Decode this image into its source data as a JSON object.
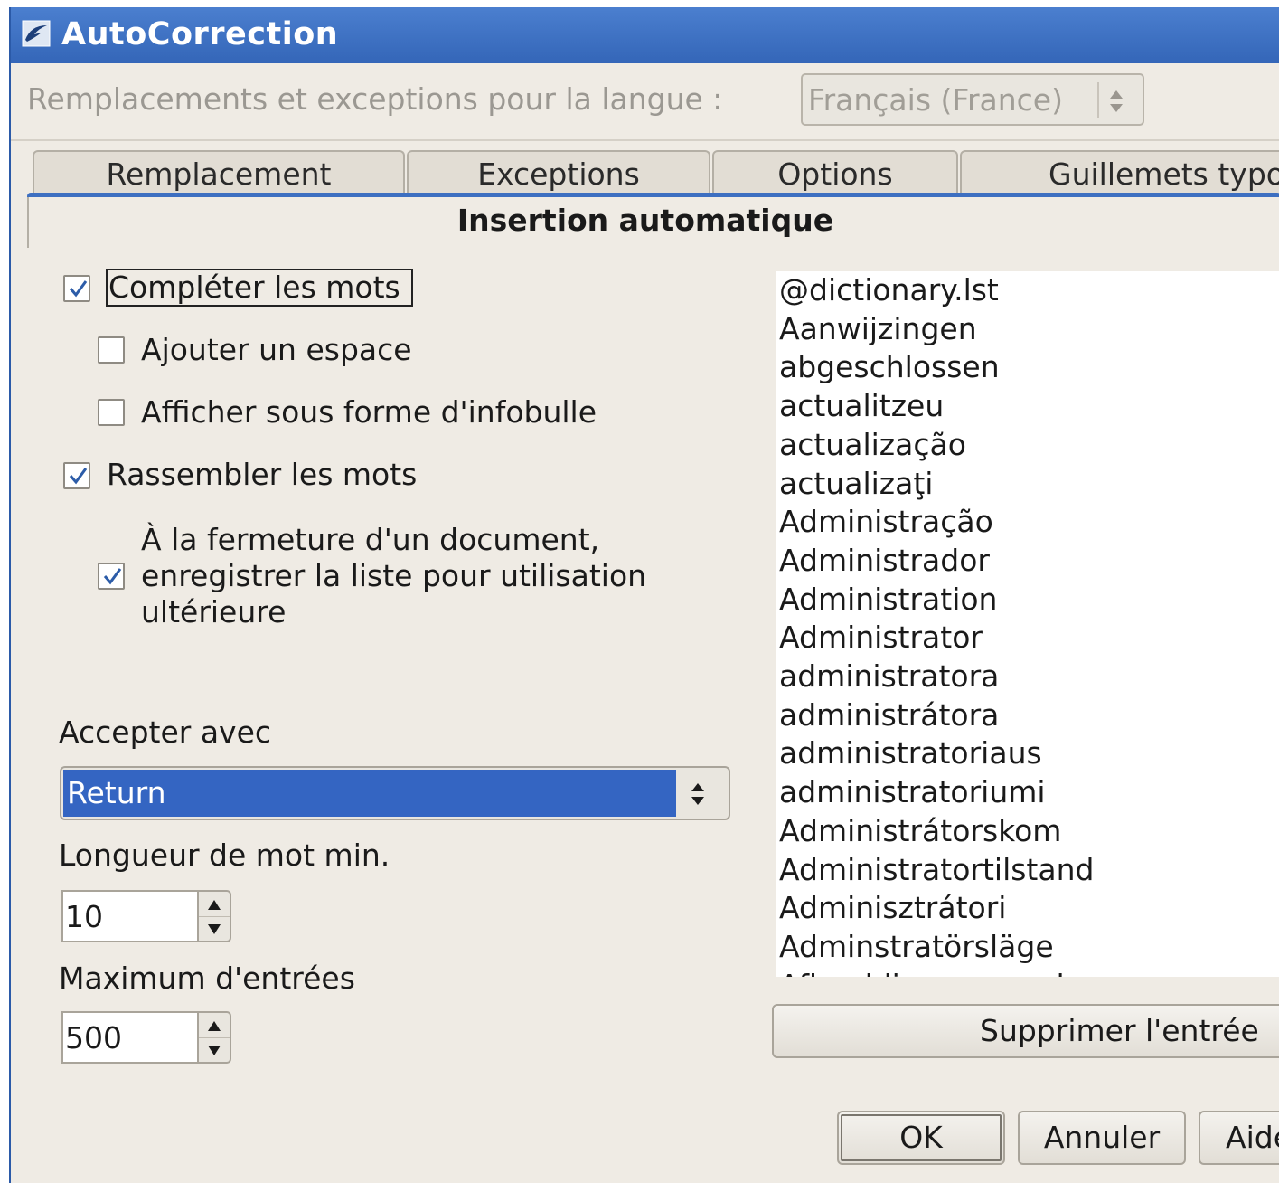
{
  "window": {
    "title": "AutoCorrection"
  },
  "language": {
    "label": "Remplacements et exceptions pour la langue :",
    "selected": "Français (France)"
  },
  "tabs": [
    {
      "label": "Remplacement"
    },
    {
      "label": "Exceptions"
    },
    {
      "label": "Options"
    },
    {
      "label": "Guillemets typographiques"
    }
  ],
  "active_tab": {
    "label": "Insertion automatique"
  },
  "options": {
    "complete_words": {
      "label": "Compléter les mots",
      "checked": true
    },
    "add_space": {
      "label": "Ajouter un espace",
      "checked": false
    },
    "show_tooltip": {
      "label": "Afficher sous forme d'infobulle",
      "checked": false
    },
    "collect_words": {
      "label": "Rassembler les mots",
      "checked": true
    },
    "save_list": {
      "line1": "À la fermeture d'un document,",
      "line2": "enregistrer la liste pour utilisation",
      "line3": "ultérieure",
      "checked": true
    }
  },
  "accept_with": {
    "label": "Accepter avec",
    "value": "Return"
  },
  "min_word_length": {
    "label": "Longueur de mot min.",
    "value": "10"
  },
  "max_entries": {
    "label": "Maximum d'entrées",
    "value": "500"
  },
  "word_list": [
    "@dictionary.lst",
    "Aanwijzingen",
    "abgeschlossen",
    "actualitzeu",
    "actualização",
    "actualizaţi",
    "Administração",
    "Administrador",
    "Administration",
    "Administrator",
    "administratora",
    "administrátora",
    "administratoriaus",
    "administratoriumi",
    "Administrátorskom",
    "Administratortilstand",
    "Adminisztrátori",
    "Adminstratörsläge",
    "Afbeeldingsopmaak"
  ],
  "buttons": {
    "delete_entry": "Supprimer l'entrée",
    "ok": "OK",
    "cancel": "Annuler",
    "help": "Aide"
  },
  "colors": {
    "titlebar": "#3466b8",
    "selection": "#3465c2",
    "dialog_bg": "#efebe4"
  }
}
